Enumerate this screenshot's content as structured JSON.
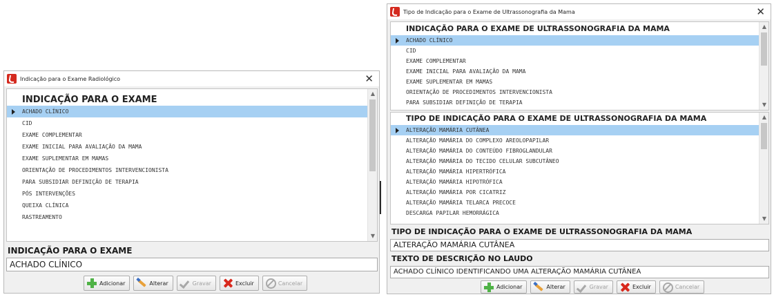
{
  "left_window": {
    "title": "Indicação para o Exame Radiológico",
    "close_glyph": "✕",
    "list_header": "INDICAÇÃO PARA O EXAME",
    "items": [
      {
        "label": "ACHADO CLÍNICO",
        "selected": true
      },
      {
        "label": "CID"
      },
      {
        "label": "EXAME COMPLEMENTAR"
      },
      {
        "label": "EXAME INICIAL PARA AVALIAÇÃO DA MAMA"
      },
      {
        "label": "EXAME SUPLEMENTAR EM MAMAS"
      },
      {
        "label": "ORIENTAÇÃO DE PROCEDIMENTOS INTERVENCIONISTA"
      },
      {
        "label": "PARA SUBSIDIAR DEFINIÇÃO DE TERAPIA"
      },
      {
        "label": "PÓS INTERVENÇÕES"
      },
      {
        "label": "QUEIXA CLÍNICA"
      },
      {
        "label": "RASTREAMENTO"
      }
    ],
    "field_label": "INDICAÇÃO PARA O EXAME",
    "field_value": "ACHADO CLÍNICO",
    "buttons": {
      "add": "Adicionar",
      "edit": "Alterar",
      "save": "Gravar",
      "delete": "Excluir",
      "cancel": "Cancelar"
    }
  },
  "right_window": {
    "title": "Tipo de Indicação para o Exame de Ultrassonografia da Mama",
    "close_glyph": "✕",
    "top_list": {
      "header": "INDICAÇÃO PARA O EXAME DE ULTRASSONOGRAFIA DA MAMA",
      "items": [
        {
          "label": "ACHADO CLÍNICO",
          "selected": true
        },
        {
          "label": "CID"
        },
        {
          "label": "EXAME COMPLEMENTAR"
        },
        {
          "label": "EXAME INICIAL PARA AVALIAÇÃO DA MAMA"
        },
        {
          "label": "EXAME SUPLEMENTAR EM MAMAS"
        },
        {
          "label": "ORIENTAÇÃO DE PROCEDIMENTOS INTERVENCIONISTA"
        },
        {
          "label": "PARA SUBSIDIAR DEFINIÇÃO DE TERAPIA"
        }
      ]
    },
    "bottom_list": {
      "header": "TIPO DE INDICAÇÃO PARA O EXAME DE ULTRASSONOGRAFIA DA MAMA",
      "items": [
        {
          "label": "ALTERAÇÃO MAMÁRIA CUTÂNEA",
          "selected": true
        },
        {
          "label": "ALTERAÇÃO MAMÁRIA DO COMPLEXO AREOLOPAPILAR"
        },
        {
          "label": "ALTERAÇÃO MAMÁRIA DO CONTEÚDO FIBROGLANDULAR"
        },
        {
          "label": "ALTERAÇÃO MAMÁRIA DO TECIDO CELULAR SUBCUTÂNEO"
        },
        {
          "label": "ALTERAÇÃO MAMÁRIA HIPERTRÓFICA"
        },
        {
          "label": "ALTERAÇÃO MAMÁRIA HIPOTRÓFICA"
        },
        {
          "label": "ALTERAÇÃO MAMÁRIA POR CICATRIZ"
        },
        {
          "label": "ALTERAÇÃO MAMÁRIA TELARCA PRECOCE"
        },
        {
          "label": "DESCARGA PAPILAR HEMORRÁGICA"
        }
      ]
    },
    "type_label": "TIPO DE INDICAÇÃO PARA O EXAME DE ULTRASSONOGRAFIA DA MAMA",
    "type_value": "ALTERAÇÃO MAMÁRIA CUTÂNEA",
    "desc_label": "TEXTO DE DESCRIÇÃO NO LAUDO",
    "desc_value": "ACHADO CLÍNICO IDENTIFICANDO UMA ALTERAÇÃO MAMÁRIA CUTÂNEA",
    "buttons": {
      "add": "Adicionar",
      "edit": "Alterar",
      "save": "Gravar",
      "delete": "Excluir",
      "cancel": "Cancelar"
    }
  },
  "colors": {
    "selection": "#a6d0f3",
    "window_bg": "#f0f0f0",
    "app_icon": "#d42a1f",
    "add_icon": "#4fb246",
    "delete_icon": "#d8281c"
  }
}
